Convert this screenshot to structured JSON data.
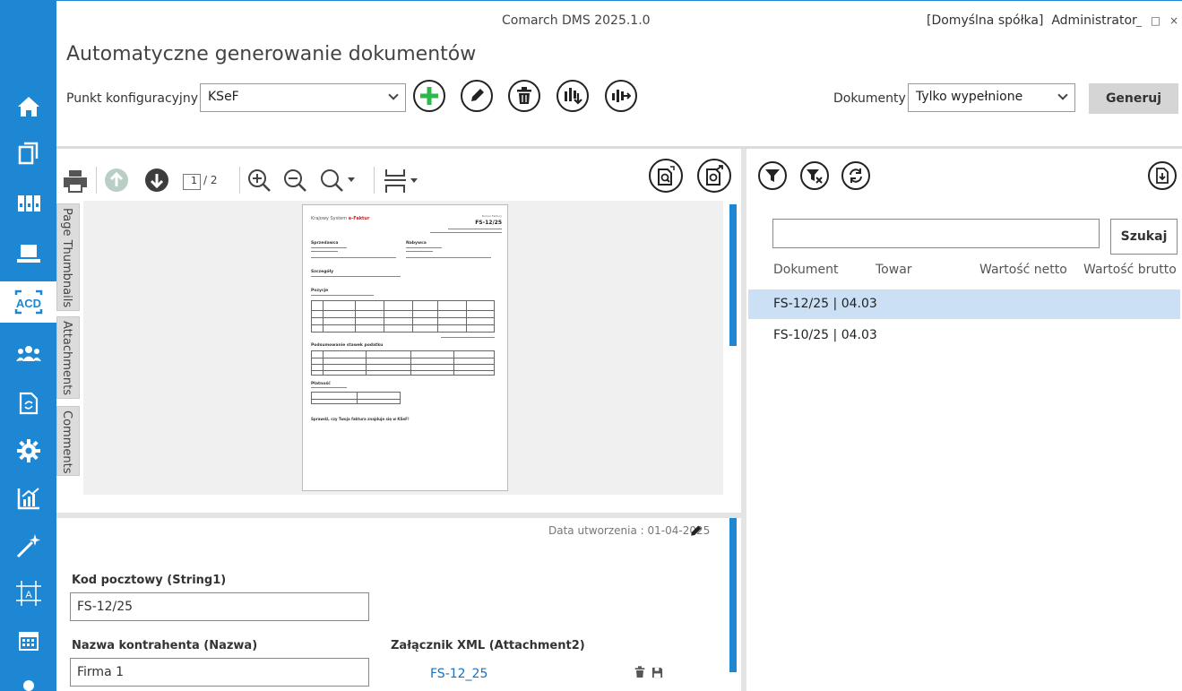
{
  "app": {
    "title": "Comarch DMS 2025.1.0",
    "user_info": "[Domyślna spółka]  Administrator",
    "window_controls": "_ □ ×"
  },
  "page": {
    "title": "Automatyczne generowanie dokumentów"
  },
  "sidebar": {
    "items": [
      {
        "icon": "home-icon"
      },
      {
        "icon": "documents-icon"
      },
      {
        "icon": "binders-icon"
      },
      {
        "icon": "laptop-icon"
      },
      {
        "icon": "acd-icon",
        "label": "ACD",
        "active": true
      },
      {
        "icon": "users-icon"
      },
      {
        "icon": "document-sync-icon"
      },
      {
        "icon": "gear-icon"
      },
      {
        "icon": "reports-chart-icon"
      },
      {
        "icon": "magic-wand-icon"
      },
      {
        "icon": "text-frame-icon",
        "label": "A"
      },
      {
        "icon": "calendar-icon"
      }
    ]
  },
  "toolbar": {
    "config_label": "Punkt konfiguracyjny",
    "config_value": "KSeF",
    "documents_label": "Dokumenty",
    "documents_value": "Tylko wypełnione",
    "generate_label": "Generuj"
  },
  "viewer": {
    "current_page": "1",
    "total_pages": "/ 2",
    "side_tabs": [
      "Page Thumbnails",
      "Attachments",
      "Comments"
    ],
    "sheet": {
      "brand": "Krajowy System",
      "brand_accent": "e-Faktur",
      "number_label": "Numer Faktury",
      "number": "FS-12/25",
      "seller": "Sprzedawca",
      "buyer": "Nabywca",
      "details": "Szczegóły",
      "positions": "Pozycje",
      "vat_summary": "Podsumowanie stawek podatku",
      "payment": "Płatność",
      "footer": "Sprawdź, czy Twoja faktura znajduje się w KSeF!"
    }
  },
  "form": {
    "created": "Data utworzenia : 01-04-2025",
    "postal_label": "Kod pocztowy (String1)",
    "postal_value": "FS-12/25",
    "contractor_label": "Nazwa kontrahenta (Nazwa)",
    "contractor_value": "Firma 1",
    "xml_label": "Załącznik XML (Attachment2)",
    "xml_link": "FS-12_25"
  },
  "results": {
    "search_label": "Szukaj",
    "search_value": "",
    "columns": [
      "Dokument",
      "Towar",
      "Wartość netto",
      "Wartość brutto"
    ],
    "rows": [
      {
        "document": "FS-12/25 | 04.03",
        "selected": true
      },
      {
        "document": "FS-10/25 | 04.03",
        "selected": false
      }
    ]
  },
  "colors": {
    "accent": "#1d87d3",
    "add_green": "#2db84d",
    "selected_row": "#cce0f5"
  }
}
